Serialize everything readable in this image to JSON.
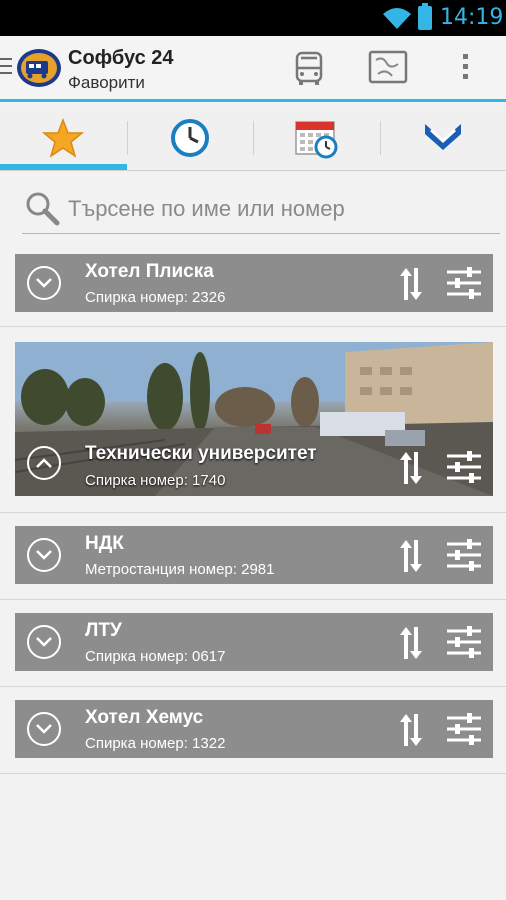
{
  "status_bar": {
    "time": "14:19"
  },
  "action_bar": {
    "title": "Софбус 24",
    "subtitle": "Фаворити"
  },
  "tabs": [
    {
      "icon": "star-icon",
      "selected": true
    },
    {
      "icon": "clock-icon",
      "selected": false
    },
    {
      "icon": "calendar-icon",
      "selected": false
    },
    {
      "icon": "metro-icon",
      "selected": false
    }
  ],
  "search": {
    "placeholder": "Търсене по име или номер"
  },
  "favorites": [
    {
      "name": "Хотел Плиска",
      "subtitle": "Спирка номер: 2326",
      "expanded": false
    },
    {
      "name": "Технически университет",
      "subtitle": "Спирка номер: 1740",
      "expanded": true
    },
    {
      "name": "НДК",
      "subtitle": "Метростанция номер: 2981",
      "expanded": false
    },
    {
      "name": "ЛТУ",
      "subtitle": "Спирка номер: 0617",
      "expanded": false
    },
    {
      "name": "Хотел Хемус",
      "subtitle": "Спирка номер: 1322",
      "expanded": false
    }
  ],
  "colors": {
    "accent": "#33b5e5",
    "card": "#8d8d8d",
    "star": "#f5a623",
    "metro": "#1a5fb4"
  }
}
